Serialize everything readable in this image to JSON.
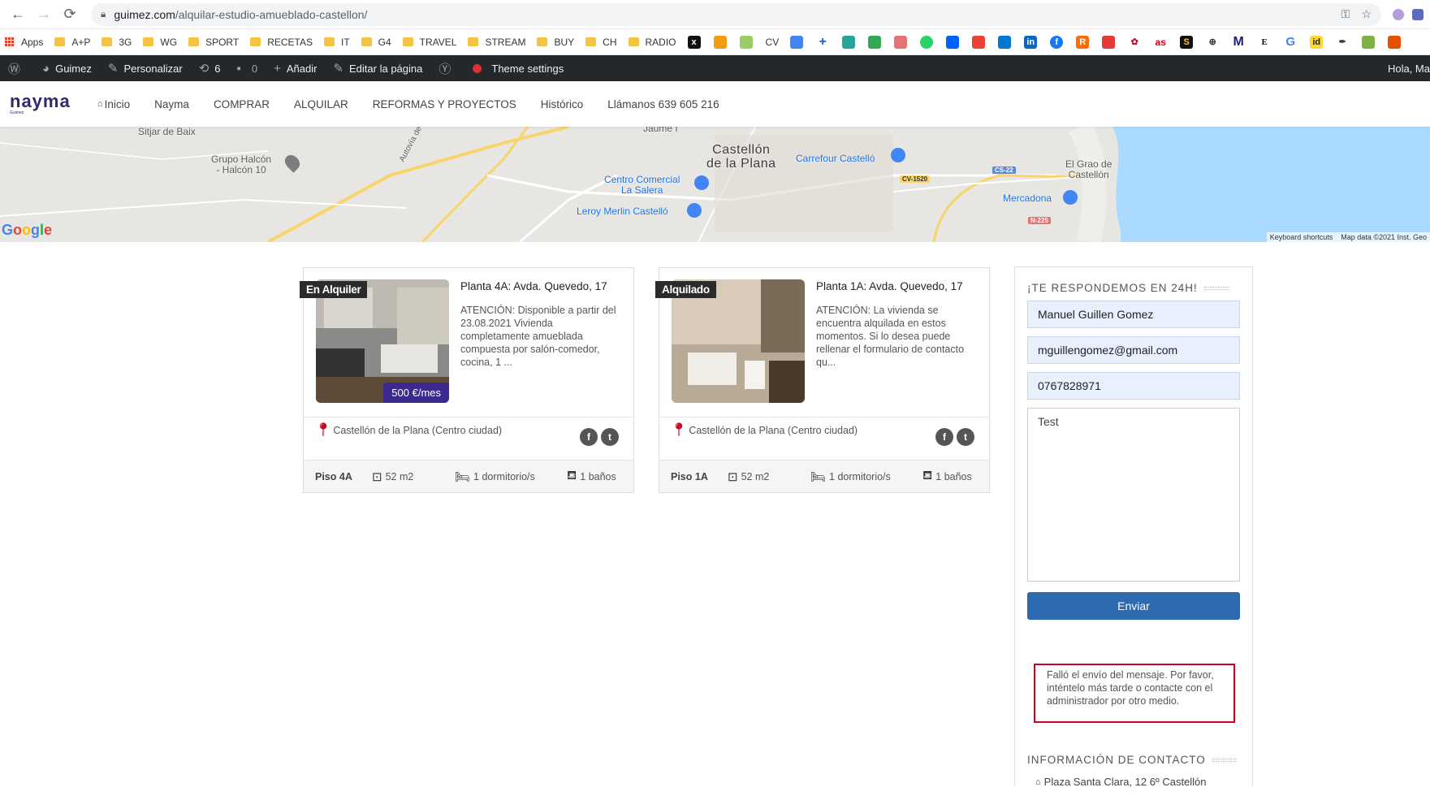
{
  "browser": {
    "url_host": "guimez.com",
    "url_path": "/alquilar-estudio-amueblado-castellon/",
    "bookmarks": [
      "Apps",
      "A+P",
      "3G",
      "WG",
      "SPORT",
      "RECETAS",
      "IT",
      "G4",
      "TRAVEL",
      "STREAM",
      "BUY",
      "CH",
      "RADIO",
      "CV"
    ]
  },
  "wpbar": {
    "site": "Guimez",
    "customize": "Personalizar",
    "updates": "6",
    "comments": "0",
    "new": "Añadir",
    "edit": "Editar la página",
    "theme": "Theme settings",
    "greeting": "Hola, Ma"
  },
  "site": {
    "logo": "nayma",
    "logo_sub": "Guimez",
    "menu": [
      "Inicio",
      "Nayma",
      "COMPRAR",
      "ALQUILAR",
      "REFORMAS Y PROYECTOS",
      "Histórico",
      "Llámanos 639 605 216"
    ]
  },
  "map": {
    "labels": {
      "sitjar": "Sitjar de Baix",
      "halcon": "Grupo Halcón\n- Halcón 10",
      "jaume": "Jaume I",
      "city": "Castellón\nde la Plana",
      "carrefour": "Carrefour Castelló",
      "centro": "Centro Comercial\nLa Salera",
      "leroy": "Leroy Merlin Castelló",
      "grao": "El Grao de\nCastellón",
      "mercadona": "Mercadona",
      "autovia": "Autovía de",
      "cv1520": "CV-1520",
      "cs22": "CS-22",
      "n225": "N-225"
    },
    "google": "Google",
    "shortcuts": "Keyboard shortcuts",
    "mapdata": "Map data ©2021 Inst. Geo"
  },
  "listings": [
    {
      "tag": "En Alquiler",
      "title": "Planta 4A: Avda. Quevedo, 17",
      "desc": "ATENCIÓN: Disponible a partir del 23.08.2021 Vivienda completamente amueblada compuesta por salón-comedor, cocina, 1 ...",
      "price": "500 €/mes",
      "location": "Castellón de la Plana (Centro ciudad)",
      "ref": "Piso 4A",
      "area": "52 m2",
      "rooms": "1 dormitorio/s",
      "baths": "1 baños"
    },
    {
      "tag": "Alquilado",
      "title": "Planta 1A: Avda. Quevedo, 17",
      "desc": "ATENCIÓN: La vivienda se encuentra  alquilada en estos momentos. Si lo desea puede rellenar el formulario de contacto qu...",
      "price": "",
      "location": "Castellón de la Plana (Centro ciudad)",
      "ref": "Piso 1A",
      "area": "52 m2",
      "rooms": "1 dormitorio/s",
      "baths": "1 baños"
    }
  ],
  "form": {
    "heading": "¡TE RESPONDEMOS EN 24H!",
    "name": "Manuel Guillen Gomez",
    "email": "mguillengomez@gmail.com",
    "phone": "0767828971",
    "message": "Test",
    "submit": "Enviar",
    "error": "Falló el envío del mensaje. Por favor, inténtelo más tarde o contacte con el administrador por otro medio."
  },
  "contact": {
    "heading": "INFORMACIÓN DE CONTACTO",
    "address": "Plaza Santa Clara, 12 6º Castellón"
  },
  "colors": {
    "wpbar": "#23282d",
    "brand": "#2d2a6e",
    "price_bg": "#3a2a8c",
    "button": "#2d6ab0",
    "error": "#d0021b"
  }
}
